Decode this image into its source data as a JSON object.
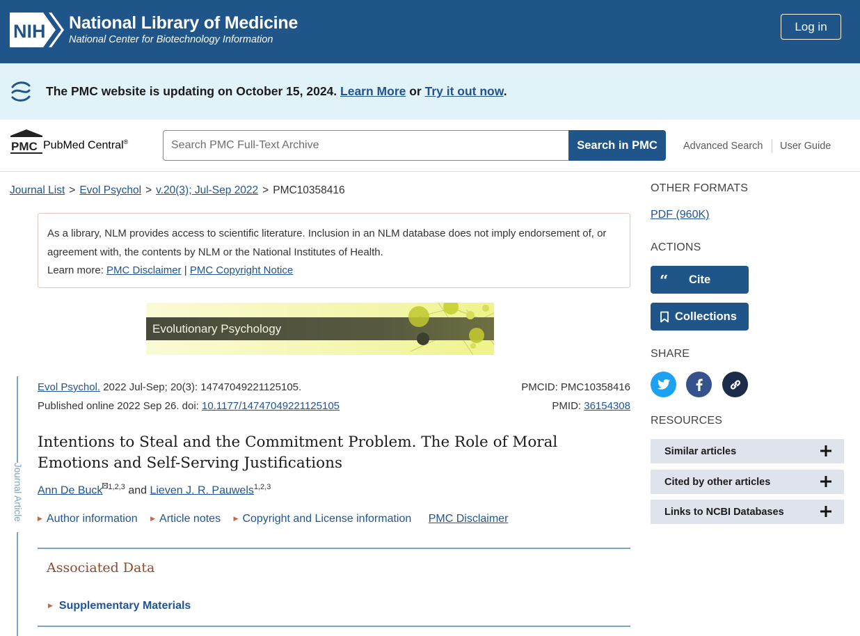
{
  "header": {
    "logo_text": "NIH",
    "title": "National Library of Medicine",
    "subtitle": "National Center for Biotechnology Information",
    "login_label": "Log in"
  },
  "banner": {
    "text": "The PMC website is updating on October 15, 2024.",
    "learn_more": "Learn More",
    "or": "or",
    "try_it": "Try it out now",
    "end": "."
  },
  "pmc_bar": {
    "logo_text": "PMC",
    "name": "PubMed Central",
    "reg": "®",
    "search_placeholder": "Search PMC Full-Text Archive",
    "search_button": "Search in PMC",
    "advanced_search": "Advanced Search",
    "user_guide": "User Guide"
  },
  "breadcrumb": {
    "items": [
      "Journal List",
      "Evol Psychol",
      "v.20(3); Jul-Sep 2022"
    ],
    "current": "PMC10358416",
    "sep": ">"
  },
  "disclaimer": {
    "text": "As a library, NLM provides access to scientific literature. Inclusion in an NLM database does not imply endorsement of, or agreement with, the contents by NLM or the National Institutes of Health.",
    "learn_more": "Learn more:",
    "link1": "PMC Disclaimer",
    "pipe": "|",
    "link2": "PMC Copyright Notice"
  },
  "journal_banner": "Evolutionary Psychology",
  "side_label": "Journal Article",
  "citation": {
    "journal": "Evol Psychol.",
    "details": "2022 Jul-Sep; 20(3): 14747049221125105.",
    "published": "Published online 2022 Sep 26. doi:",
    "doi": "10.1177/14747049221125105",
    "pmcid_label": "PMCID:",
    "pmcid": "PMC10358416",
    "pmid_label": "PMID:",
    "pmid": "36154308"
  },
  "article": {
    "title": "Intentions to Steal and the Commitment Problem. The Role of Moral Emotions and Self-Serving Justifications",
    "author1": "Ann De Buck",
    "author1_sup": "1,2,3",
    "and": "and",
    "author2": "Lieven J. R. Pauwels",
    "author2_sup": "1,2,3"
  },
  "info_links": {
    "author_info": "Author information",
    "article_notes": "Article notes",
    "copyright": "Copyright and License information",
    "disclaimer": "PMC Disclaimer"
  },
  "associated_data": {
    "title": "Associated Data",
    "supplementary": "Supplementary Materials"
  },
  "sidebar": {
    "other_formats": "OTHER FORMATS",
    "pdf": "PDF (960K)",
    "actions": "ACTIONS",
    "cite": "Cite",
    "collections": "Collections",
    "share": "SHARE",
    "resources": "RESOURCES",
    "resource_items": [
      "Similar articles",
      "Cited by other articles",
      "Links to NCBI Databases"
    ]
  },
  "colors": {
    "header_blue": "#20558a",
    "banner_bg": "#e1f3f8",
    "link": "#205493",
    "twitter": "#1da1f2",
    "facebook": "#35528c",
    "copy_link": "#1b2b4a",
    "resource_bg": "#dfe3ec"
  }
}
